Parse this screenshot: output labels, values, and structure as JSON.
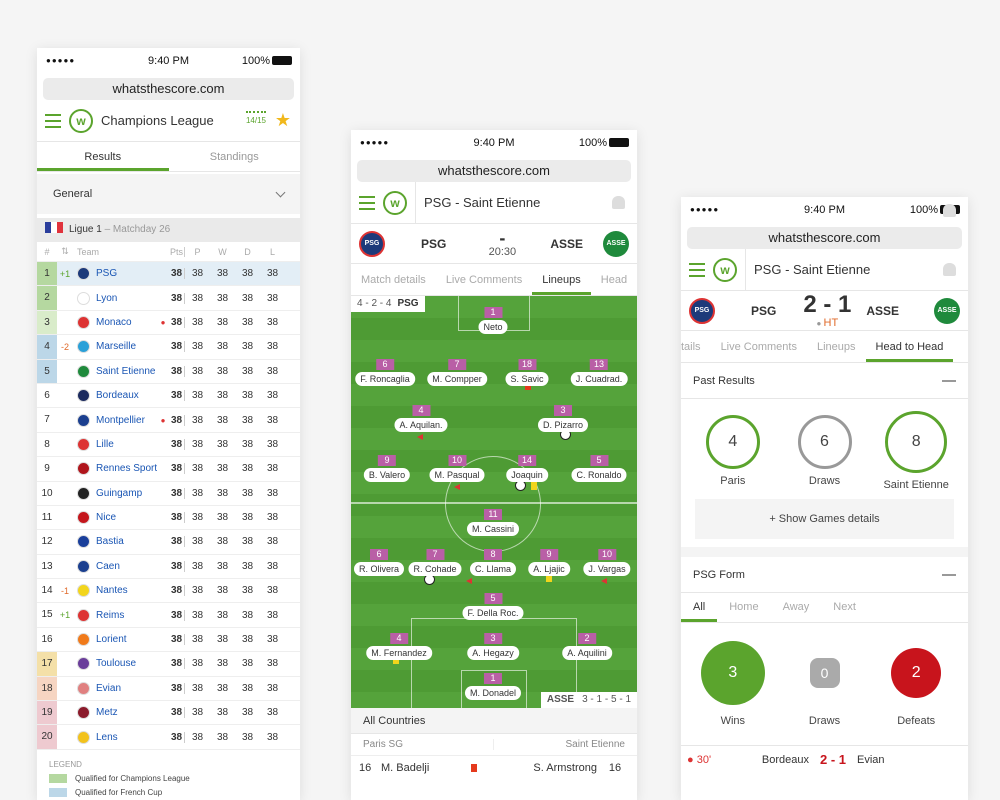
{
  "status": {
    "time": "9:40 PM",
    "battery": "100%",
    "signal": "●●●●●"
  },
  "url": "whatsthescore.com",
  "colors": {
    "accent": "#5ba42d",
    "psg_num": "#b95fa6",
    "red": "#e53a1d"
  },
  "phone1": {
    "title": "Champions League",
    "season_icon": "14/15",
    "tabs": [
      "Results",
      "Standings"
    ],
    "filter": "General",
    "league": {
      "name": "Ligue 1",
      "matchday": "– Matchday 26"
    },
    "headers": [
      "#",
      "",
      "Team",
      "Pts",
      "P",
      "W",
      "D",
      "L"
    ],
    "rows": [
      {
        "pos": "1",
        "change": "+1",
        "team": "PSG",
        "dot": "",
        "pts": "38",
        "p": "38",
        "w": "38",
        "d": "38",
        "l": "38",
        "posbg": "#b5d8a0",
        "rowbg": "#e3eef6",
        "badge": "#1d3a7a"
      },
      {
        "pos": "2",
        "change": "",
        "team": "Lyon",
        "dot": "",
        "pts": "38",
        "p": "38",
        "w": "38",
        "d": "38",
        "l": "38",
        "posbg": "#b5d8a0",
        "rowbg": "",
        "badge": "#ffffff"
      },
      {
        "pos": "3",
        "change": "",
        "team": "Monaco",
        "dot": "●",
        "pts": "38",
        "p": "38",
        "w": "38",
        "d": "38",
        "l": "38",
        "posbg": "#d9ecca",
        "rowbg": "",
        "badge": "#d33"
      },
      {
        "pos": "4",
        "change": "-2",
        "team": "Marseille",
        "dot": "",
        "pts": "38",
        "p": "38",
        "w": "38",
        "d": "38",
        "l": "38",
        "posbg": "#bcd7e8",
        "rowbg": "",
        "badge": "#2aa0d8"
      },
      {
        "pos": "5",
        "change": "",
        "team": "Saint Etienne",
        "dot": "",
        "pts": "38",
        "p": "38",
        "w": "38",
        "d": "38",
        "l": "38",
        "posbg": "#bcd7e8",
        "rowbg": "",
        "badge": "#1f8a3c"
      },
      {
        "pos": "6",
        "change": "",
        "team": "Bordeaux",
        "dot": "",
        "pts": "38",
        "p": "38",
        "w": "38",
        "d": "38",
        "l": "38",
        "posbg": "",
        "rowbg": "",
        "badge": "#1b2a5e"
      },
      {
        "pos": "7",
        "change": "",
        "team": "Montpellier",
        "dot": "●",
        "pts": "38",
        "p": "38",
        "w": "38",
        "d": "38",
        "l": "38",
        "posbg": "",
        "rowbg": "",
        "badge": "#1b3f8f"
      },
      {
        "pos": "8",
        "change": "",
        "team": "Lille",
        "dot": "",
        "pts": "38",
        "p": "38",
        "w": "38",
        "d": "38",
        "l": "38",
        "posbg": "",
        "rowbg": "",
        "badge": "#d33"
      },
      {
        "pos": "9",
        "change": "",
        "team": "Rennes Sport...",
        "dot": "",
        "pts": "38",
        "p": "38",
        "w": "38",
        "d": "38",
        "l": "38",
        "posbg": "",
        "rowbg": "",
        "badge": "#b0151c"
      },
      {
        "pos": "10",
        "change": "",
        "team": "Guingamp",
        "dot": "",
        "pts": "38",
        "p": "38",
        "w": "38",
        "d": "38",
        "l": "38",
        "posbg": "",
        "rowbg": "",
        "badge": "#222222"
      },
      {
        "pos": "11",
        "change": "",
        "team": "Nice",
        "dot": "",
        "pts": "38",
        "p": "38",
        "w": "38",
        "d": "38",
        "l": "38",
        "posbg": "",
        "rowbg": "",
        "badge": "#c4161c"
      },
      {
        "pos": "12",
        "change": "",
        "team": "Bastia",
        "dot": "",
        "pts": "38",
        "p": "38",
        "w": "38",
        "d": "38",
        "l": "38",
        "posbg": "",
        "rowbg": "",
        "badge": "#1a3f9b"
      },
      {
        "pos": "13",
        "change": "",
        "team": "Caen",
        "dot": "",
        "pts": "38",
        "p": "38",
        "w": "38",
        "d": "38",
        "l": "38",
        "posbg": "",
        "rowbg": "",
        "badge": "#1b3f8f"
      },
      {
        "pos": "14",
        "change": "-1",
        "team": "Nantes",
        "dot": "",
        "pts": "38",
        "p": "38",
        "w": "38",
        "d": "38",
        "l": "38",
        "posbg": "",
        "rowbg": "",
        "badge": "#f2d51c"
      },
      {
        "pos": "15",
        "change": "+1",
        "team": "Reims",
        "dot": "",
        "pts": "38",
        "p": "38",
        "w": "38",
        "d": "38",
        "l": "38",
        "posbg": "",
        "rowbg": "",
        "badge": "#d33"
      },
      {
        "pos": "16",
        "change": "",
        "team": "Lorient",
        "dot": "",
        "pts": "38",
        "p": "38",
        "w": "38",
        "d": "38",
        "l": "38",
        "posbg": "",
        "rowbg": "",
        "badge": "#f07a1a"
      },
      {
        "pos": "17",
        "change": "",
        "team": "Toulouse",
        "dot": "",
        "pts": "38",
        "p": "38",
        "w": "38",
        "d": "38",
        "l": "38",
        "posbg": "#f4e0a8",
        "rowbg": "",
        "badge": "#6a3d9a"
      },
      {
        "pos": "18",
        "change": "",
        "team": "Evian",
        "dot": "",
        "pts": "38",
        "p": "38",
        "w": "38",
        "d": "38",
        "l": "38",
        "posbg": "#f6d5c2",
        "rowbg": "",
        "badge": "#e08080"
      },
      {
        "pos": "19",
        "change": "",
        "team": "Metz",
        "dot": "",
        "pts": "38",
        "p": "38",
        "w": "38",
        "d": "38",
        "l": "38",
        "posbg": "#eecad0",
        "rowbg": "",
        "badge": "#8b1a2b"
      },
      {
        "pos": "20",
        "change": "",
        "team": "Lens",
        "dot": "",
        "pts": "38",
        "p": "38",
        "w": "38",
        "d": "38",
        "l": "38",
        "posbg": "#eecad0",
        "rowbg": "",
        "badge": "#f2c21c"
      }
    ],
    "legend_title": "LEGEND",
    "legend": [
      {
        "label": "Qualified for Champions League",
        "color": "#b5d8a0"
      },
      {
        "label": "Qualified for French Cup",
        "color": "#bcd7e8"
      }
    ]
  },
  "phone2": {
    "title": "PSG - Saint Etienne",
    "home": "PSG",
    "away": "ASSE",
    "score": "-",
    "kickoff": "20:30",
    "tabs": [
      "Match details",
      "Live Comments",
      "Lineups",
      "Head"
    ],
    "home_formation": "4 - 2 - 4",
    "home_label": "PSG",
    "away_label": "ASSE",
    "away_formation": "3 - 1 - 5 - 1",
    "home_players": [
      {
        "num": "1",
        "name": "Neto"
      },
      {
        "num": "6",
        "name": "F. Roncaglia"
      },
      {
        "num": "7",
        "name": "M. Compper"
      },
      {
        "num": "18",
        "name": "S. Savic"
      },
      {
        "num": "13",
        "name": "J. Cuadrad."
      },
      {
        "num": "4",
        "name": "A. Aquilan."
      },
      {
        "num": "3",
        "name": "D. Pizarro"
      },
      {
        "num": "9",
        "name": "B. Valero"
      },
      {
        "num": "10",
        "name": "M. Pasqual"
      },
      {
        "num": "14",
        "name": "Joaquin"
      },
      {
        "num": "5",
        "name": "C. Ronaldo"
      }
    ],
    "away_players": [
      {
        "num": "11",
        "name": "M. Cassini"
      },
      {
        "num": "6",
        "name": "R. Olivera"
      },
      {
        "num": "7",
        "name": "R. Cohade"
      },
      {
        "num": "8",
        "name": "C. Llama"
      },
      {
        "num": "9",
        "name": "A. Ljajic"
      },
      {
        "num": "10",
        "name": "J. Vargas"
      },
      {
        "num": "5",
        "name": "F. Della Roc."
      },
      {
        "num": "4",
        "name": "M. Fernandez"
      },
      {
        "num": "3",
        "name": "A. Hegazy"
      },
      {
        "num": "2",
        "name": "A. Aquilini"
      },
      {
        "num": "1",
        "name": "M. Donadel"
      }
    ],
    "subs_title": "All Countries",
    "subs_home": "Paris SG",
    "subs_away": "Saint Etienne",
    "subs_row": {
      "num_home": "16",
      "name_home": "M. Badelji",
      "name_away": "S. Armstrong",
      "num_away": "16"
    }
  },
  "phone3": {
    "title": "PSG - Saint Etienne",
    "home": "PSG",
    "away": "ASSE",
    "score": "2 - 1",
    "period": "HT",
    "tabs": [
      "tails",
      "Live Comments",
      "Lineups",
      "Head to Head"
    ],
    "past_title": "Past Results",
    "past": [
      {
        "value": "4",
        "label": "Paris"
      },
      {
        "value": "6",
        "label": "Draws"
      },
      {
        "value": "8",
        "label": "Saint Etienne"
      }
    ],
    "show_details": "+ Show Games details",
    "form_title": "PSG Form",
    "form_tabs": [
      "All",
      "Home",
      "Away",
      "Next"
    ],
    "form": [
      {
        "value": "3",
        "label": "Wins",
        "color": "#5ba42d"
      },
      {
        "value": "0",
        "label": "Draws",
        "color": "#aaaaaa"
      },
      {
        "value": "2",
        "label": "Defeats",
        "color": "#c8141c"
      }
    ],
    "last_match": {
      "minute": "30'",
      "home": "Bordeaux",
      "score": "2 - 1",
      "away": "Evian"
    }
  }
}
